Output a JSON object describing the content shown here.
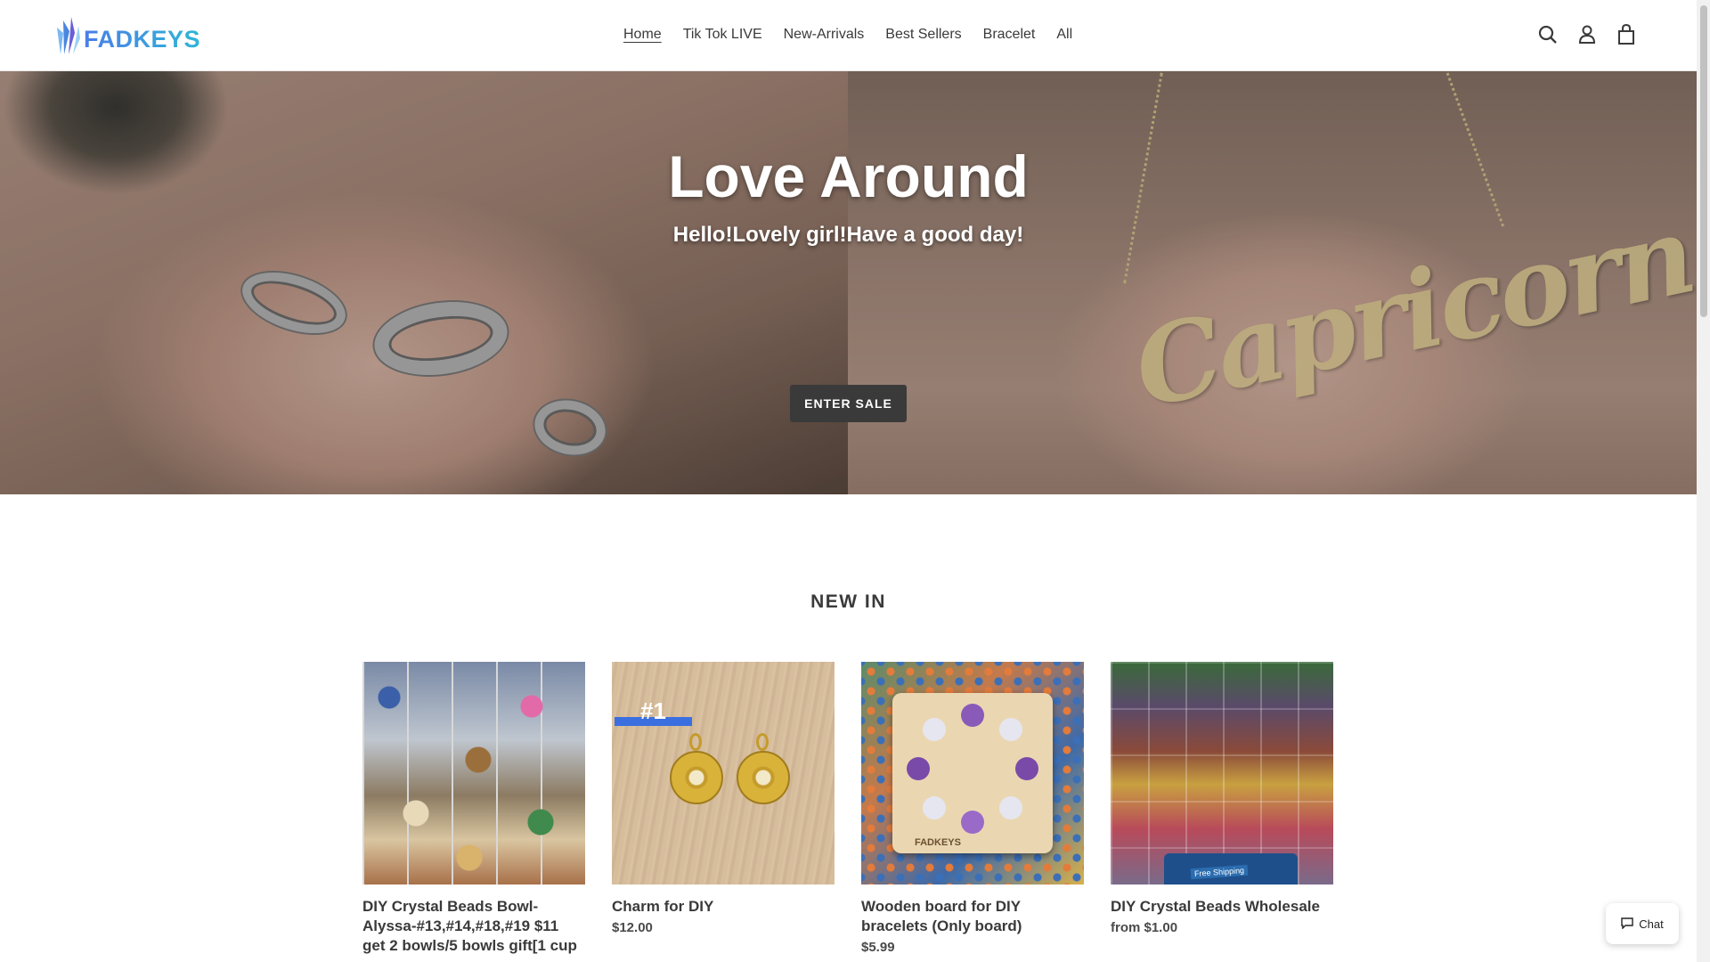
{
  "brand": {
    "logo_text": "FADKEYS",
    "accent": "#3a3a3a"
  },
  "nav": {
    "items": [
      {
        "label": "Home",
        "active": true
      },
      {
        "label": "Tik Tok LIVE",
        "active": false
      },
      {
        "label": "New-Arrivals",
        "active": false
      },
      {
        "label": "Best Sellers",
        "active": false
      },
      {
        "label": "Bracelet",
        "active": false
      },
      {
        "label": "All",
        "active": false
      }
    ]
  },
  "header_icons": [
    "search-icon",
    "account-icon",
    "cart-icon"
  ],
  "hero": {
    "title": "Love Around",
    "subtitle": "Hello!Lovely girl!Have a good day!",
    "button_label": "ENTER SALE",
    "necklace_text": "Capricorn"
  },
  "section": {
    "title": "NEW IN"
  },
  "products": [
    {
      "title": "DIY Crystal Beads Bowl-Alyssa-#13,#14,#18,#19 $11 get 2 bowls/5 bowls gift[1 cup",
      "price": ""
    },
    {
      "title": "Charm for DIY",
      "price": "$12.00",
      "badge": "#1"
    },
    {
      "title": "Wooden board for DIY bracelets (Only board)",
      "price": "$5.99",
      "board_text": "FADKEYS"
    },
    {
      "title": "DIY Crystal Beads Wholesale",
      "price": "from $1.00",
      "bag_text": "Free Shipping"
    }
  ],
  "chat": {
    "label": "Chat"
  }
}
